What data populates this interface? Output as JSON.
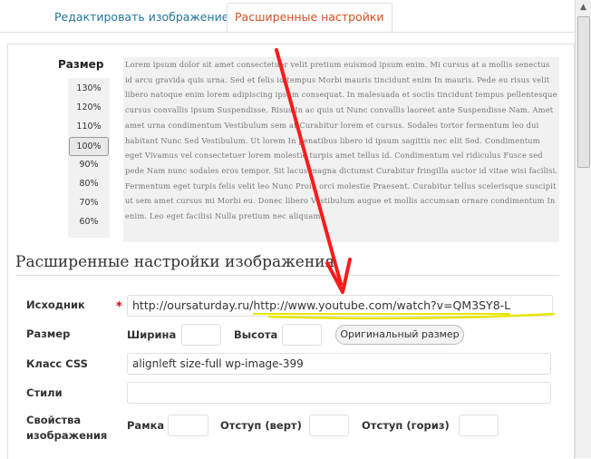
{
  "tabs": {
    "edit_image": "Редактировать изображение",
    "advanced": "Расширенные настройки"
  },
  "size": {
    "label": "Размер",
    "options": [
      "130%",
      "120%",
      "110%",
      "100%",
      "90%",
      "80%",
      "70%",
      "60%"
    ],
    "selected": "100%"
  },
  "preview_text": "Lorem ipsum dolor sit amet consectetuer velit pretium euismod ipsum enim. Mi cursus at a mollis senectus id arcu gravida quis urna. Sed et felis id tempus Morbi mauris tincidunt enim In mauris. Pede eu risus velit libero natoque enim lorem adipiscing ipsum consequat. In malesuada et sociis tincidunt tempus pellentesque cursus convallis ipsum Suspendisse. Risus In ac quis ut Nunc convallis laoreet ante Suspendisse Nam. Amet amet urna condimentum Vestibulum sem at Curabitur lorem et cursus. Sodales tortor fermentum leo dui habitant Nunc Sed Vestibulum. Ut lorem In penatibus libero id ipsum sagittis nec elit Sed. Condimentum eget Vivamus vel consectetuer lorem molestie turpis amet tellus id. Condimentum vel ridiculus Fusce sed pede Nam nunc sodales eros tempor. Sit lacus magna dictumst Curabitur fringilla auctor id vitae wisi facilisi. Fermentum eget turpis felis velit leo Nunc Proin orci molestie Praesent. Curabitur tellus scelerisque suscipit ut sem amet cursus mi Morbi eu. Donec libero Vestibulum augue et mollis accumsan ornare condimentum In enim. Leo eget facilisi Nulla pretium nec aliquam.",
  "section_title": "Расширенные настройки изображения",
  "form": {
    "source_label": "Исходник",
    "required_mark": "*",
    "source_value_prefix": "http://oursaturday.ru/",
    "source_value_link": "http://www.youtube.com/watch?v=QM3SY8-L",
    "size_label": "Размер",
    "width_label": "Ширина",
    "width_value": "",
    "height_label": "Высота",
    "height_value": "",
    "original_size_button": "Оригинальный размер",
    "css_class_label": "Класс CSS",
    "css_class_value": "alignleft size-full wp-image-399",
    "styles_label": "Стили",
    "styles_value": "",
    "image_props_label_line1": "Свойства",
    "image_props_label_line2": "изображения",
    "border_label": "Рамка",
    "border_value": "",
    "vspace_label": "Отступ (верт)",
    "vspace_value": "",
    "hspace_label": "Отступ (гориз)",
    "hspace_value": ""
  },
  "colors": {
    "active_tab": "#d54e21",
    "inactive_tab": "#21759b",
    "annotation_arrow": "#ff0000",
    "annotation_underline": "#e8e600"
  }
}
